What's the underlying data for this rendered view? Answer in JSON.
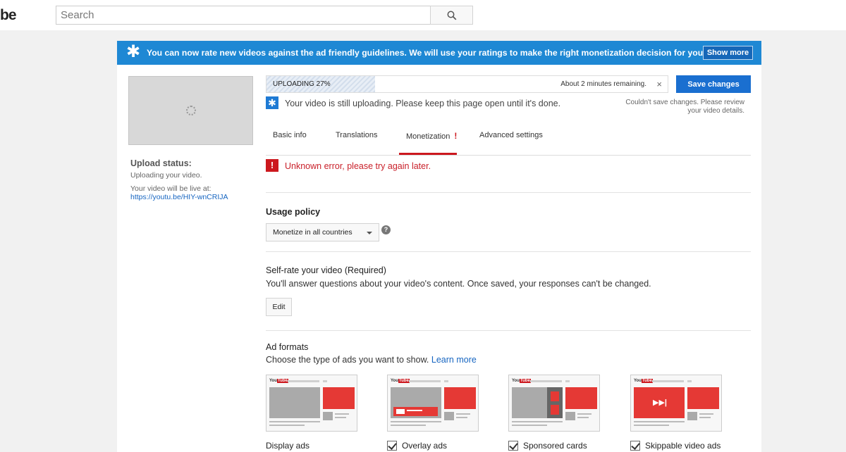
{
  "header": {
    "logo_text": "be",
    "search_placeholder": "Search"
  },
  "banner": {
    "message": "You can now rate new videos against the ad friendly guidelines. We will use your ratings to make the right monetization decision for your video.",
    "show_more": "Show more"
  },
  "upload": {
    "progress_label": "UPLOADING 27%",
    "progress_fraction": 0.27,
    "remaining": "About 2 minutes remaining.",
    "close": "×",
    "save_changes": "Save changes",
    "save_error": "Couldn't save changes. Please review your video details.",
    "still_uploading": "Your video is still uploading. Please keep this page open until it's done.",
    "status_title": "Upload status:",
    "status_line": "Uploading your video.",
    "live_at_label": "Your video will be live at:",
    "live_url": "https://youtu.be/HIY-wnCRIJA"
  },
  "tabs": [
    {
      "label": "Basic info"
    },
    {
      "label": "Translations"
    },
    {
      "label": "Monetization",
      "alert": "!"
    },
    {
      "label": "Advanced settings"
    }
  ],
  "error": {
    "icon_text": "!",
    "message": "Unknown error, please try again later."
  },
  "usage_policy": {
    "title": "Usage policy",
    "selected": "Monetize in all countries",
    "help": "?"
  },
  "self_rate": {
    "title": "Self-rate your video (Required)",
    "description": "You'll answer questions about your video's content. Once saved, your responses can't be changed.",
    "edit": "Edit"
  },
  "ad_formats": {
    "title": "Ad formats",
    "description": "Choose the type of ads you want to show.",
    "learn_more": "Learn more",
    "thumb_brand": "You",
    "thumb_brand_tube": "Tube",
    "items": [
      {
        "label": "Display ads",
        "checked": false
      },
      {
        "label": "Overlay ads",
        "checked": true
      },
      {
        "label": "Sponsored cards",
        "checked": true
      },
      {
        "label": "Skippable video ads",
        "checked": true
      }
    ]
  },
  "colors": {
    "banner": "#1e88d4",
    "accent_red": "#cc181e",
    "save_button": "#1a6fd0",
    "link": "#1665c1"
  }
}
